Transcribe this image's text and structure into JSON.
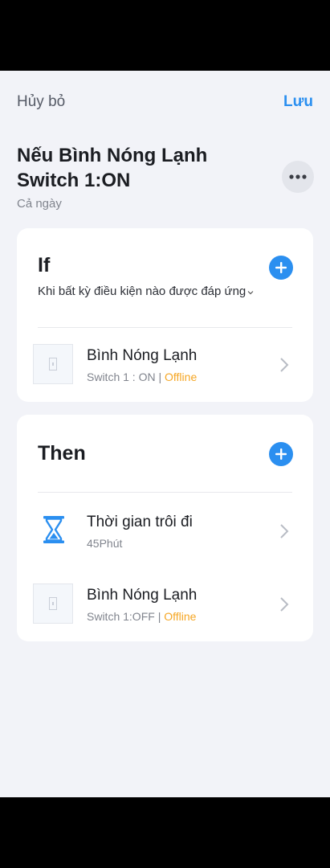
{
  "header": {
    "cancel_label": "Hủy bỏ",
    "save_label": "Lưu"
  },
  "scene": {
    "title": "Nếu Bình Nóng Lạnh Switch 1:ON",
    "subtitle": "Cả ngày"
  },
  "if_section": {
    "heading": "If",
    "condition_mode": "Khi bất kỳ điều kiện nào được đáp ứng",
    "items": [
      {
        "title": "Bình Nóng Lạnh",
        "state": "Switch 1 : ON",
        "separator": "|",
        "status": "Offline"
      }
    ]
  },
  "then_section": {
    "heading": "Then",
    "items": [
      {
        "title": "Thời gian trôi đi",
        "detail": "45Phút",
        "icon": "hourglass-icon"
      },
      {
        "title": "Bình Nóng Lạnh",
        "state": "Switch 1:OFF",
        "separator": "|",
        "status": "Offline"
      }
    ]
  },
  "colors": {
    "accent": "#2b8ff0",
    "offline": "#f5a623",
    "background": "#f2f3f8"
  }
}
